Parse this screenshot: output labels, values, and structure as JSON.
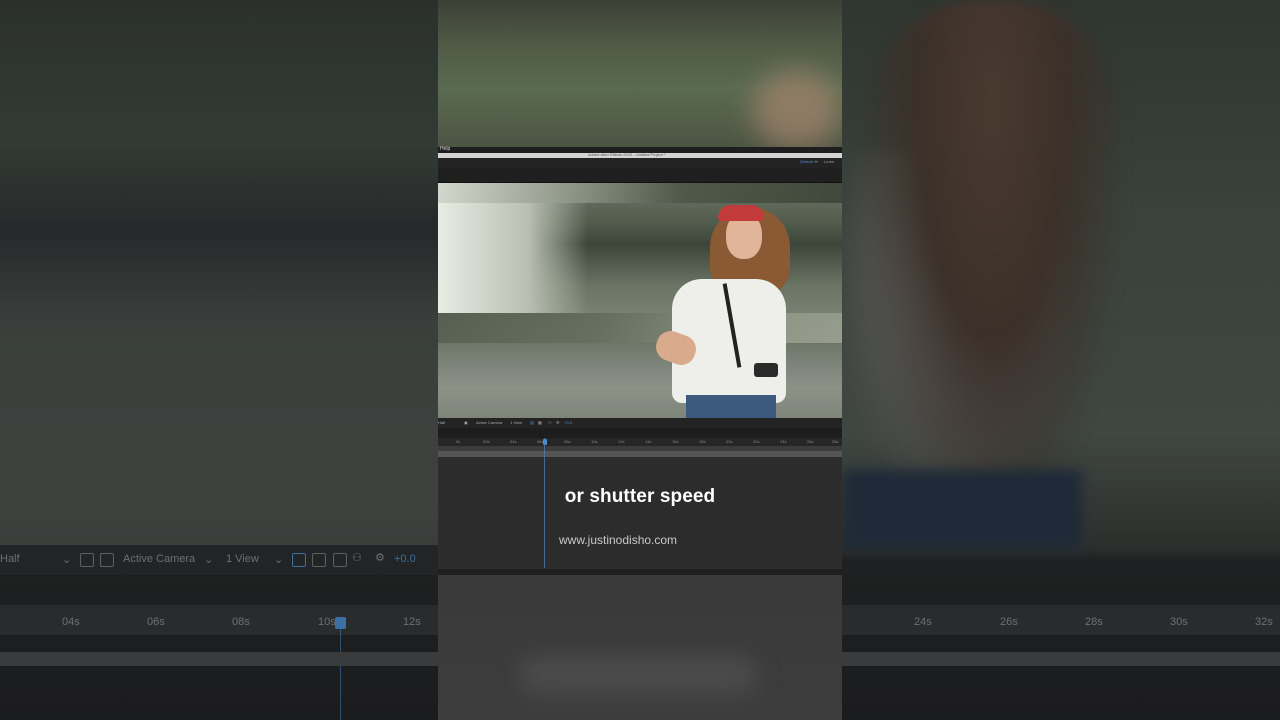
{
  "app": {
    "menu_item": "Help",
    "window_title": "Adobe After Effects 2020 - Untitled Project *",
    "workspaces": [
      "Default",
      "≫",
      "Learn"
    ]
  },
  "viewer_controls": {
    "resolution": "Half",
    "camera": "Active Camera",
    "views": "1 View",
    "exposure": "+0.0"
  },
  "timeline": {
    "left_ticks": [
      "04s",
      "06s",
      "08s",
      "10s",
      "12s"
    ],
    "right_ticks": [
      "24s",
      "26s",
      "28s",
      "30s",
      "32s"
    ],
    "center_ticks": [
      "0s",
      "02s",
      "04s",
      "06s",
      "08s",
      "10s",
      "12s",
      "14s",
      "16s",
      "18s",
      "20s",
      "22s",
      "24s",
      "26s",
      "28s",
      "30s"
    ]
  },
  "overlay": {
    "caption": "or shutter speed",
    "website": "www.justinodisho.com"
  },
  "colors": {
    "accent": "#4f91d6",
    "caption": "#ffffff"
  }
}
